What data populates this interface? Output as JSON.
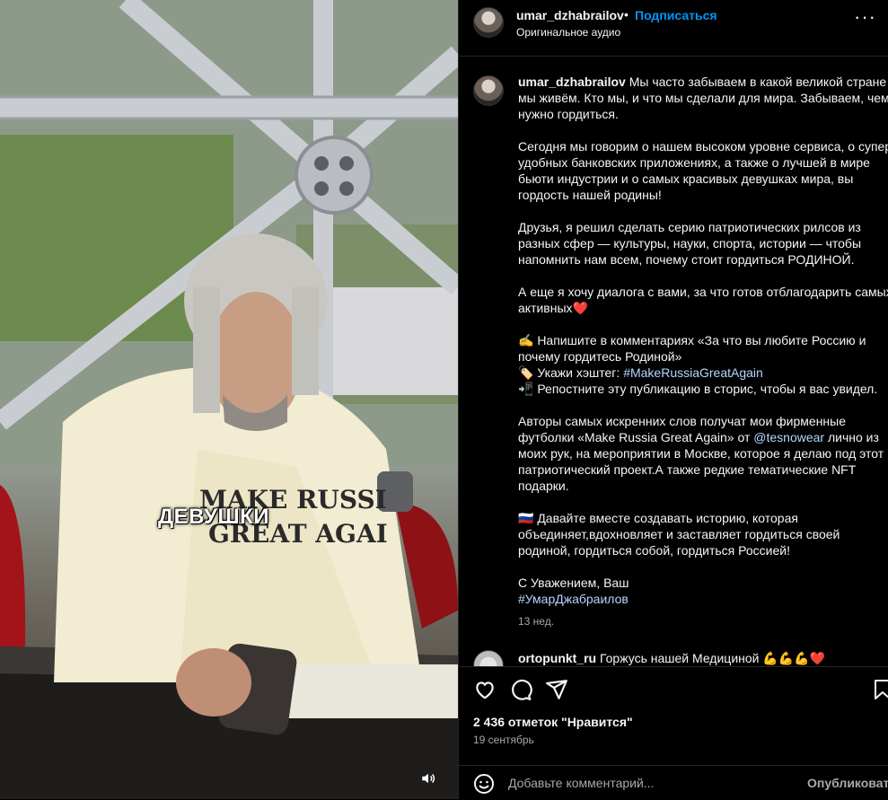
{
  "media": {
    "overlay_text": "ДЕВУШКИ",
    "shirt_text_line1": "MAKE RUSSI",
    "shirt_text_line2": "GREAT AGAI",
    "volume_icon": "speaker-icon"
  },
  "header": {
    "username": "umar_dzhabrailov",
    "separator": "•",
    "follow_label": "Подписаться",
    "audio_label": "Оригинальное аудио",
    "more_icon": "more-options-icon"
  },
  "caption": {
    "username": "umar_dzhabrailov",
    "p1": " Мы часто забываем в какой великой стране мы живём. Кто мы, и что мы сделали для мира. Забываем, чем нужно гордиться.",
    "p2": "Сегодня мы говорим о нашем высоком уровне сервиса, о супер удобных банковских приложениях, а также о лучшей в мире бьюти индустрии и о самых красивых девушках мира, вы гордость нашей родины!",
    "p3": "Друзья, я решил сделать серию патриотических рилсов из разных сфер — культуры, науки, спорта, истории — чтобы напомнить нам всем, почему стоит гордиться РОДИНОЙ.",
    "p4": "А еще я хочу диалога с вами, за что готов отблагодарить самых активных❤️",
    "p5_line1": "✍️ Напишите в комментариях «За что вы любите Россию и почему гордитесь Родиной»",
    "p5_line2_prefix": "🏷️ Укажи хэштег: ",
    "p5_hashtag": "#MakeRussiaGreatAgain",
    "p5_line3": "📲 Репостните эту публикацию в сторис, чтобы я вас увидел.",
    "p6_prefix": "Авторы самых искренних слов получат мои фирменные футболки «Make Russia Great Again» от ",
    "p6_mention": "@tesnowear",
    "p6_suffix": " лично из моих рук, на мероприятии в Москве, которое я делаю под этот патриотический проект.А также редкие тематические NFT подарки.",
    "p7": "🇷🇺 Давайте вместе создавать историю, которая объединяет,вдохновляет и заставляет гордиться своей родиной, гордиться собой, гордиться Россией!",
    "p8_line1": "С Уважением, Ваш",
    "p8_hashtag": "#УмарДжабраилов",
    "time": "13 нед."
  },
  "comment1": {
    "username": "ortopunkt_ru",
    "text": " Горжусь нашей Медициной ",
    "emojis": "💪💪💪",
    "heart": "❤️"
  },
  "actions": {
    "like_icon": "heart-icon",
    "comment_icon": "comment-icon",
    "share_icon": "share-icon",
    "save_icon": "bookmark-icon"
  },
  "likes_text": "2 436 отметок \"Нравится\"",
  "date_text": "19 сентябрь",
  "add_comment": {
    "placeholder": "Добавьте комментарий...",
    "publish_label": "Опубликовать",
    "emoji_icon": "smiley-icon"
  }
}
